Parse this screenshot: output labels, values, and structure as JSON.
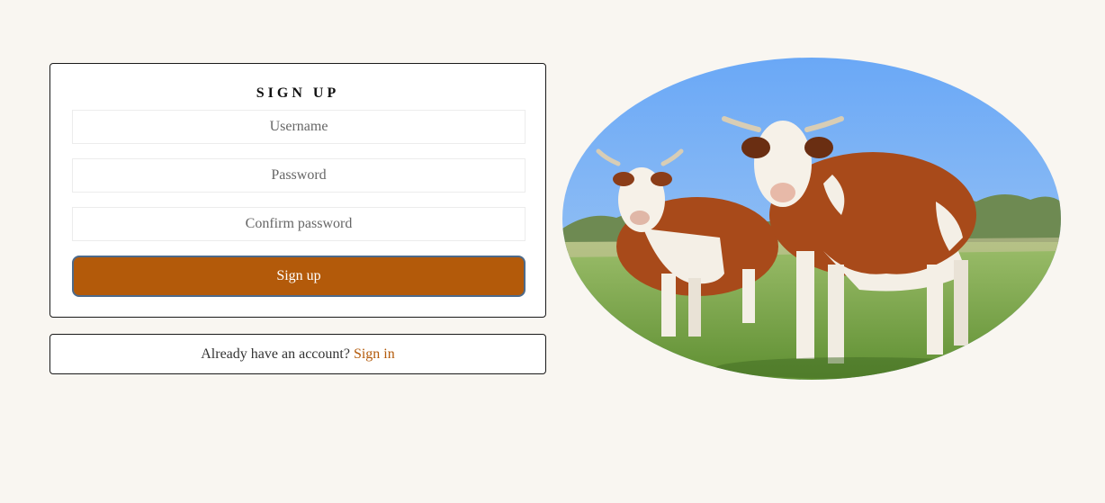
{
  "signup": {
    "title": "SIGN UP",
    "username_placeholder": "Username",
    "password_placeholder": "Password",
    "confirm_placeholder": "Confirm password",
    "submit_label": "Sign up"
  },
  "signin": {
    "prompt": "Already have an account?",
    "link_label": "Sign in"
  },
  "colors": {
    "background": "#f9f6f1",
    "accent": "#b35a0a",
    "button_border": "#4d6a8a"
  },
  "hero": {
    "icon": "cows-in-pasture-image"
  }
}
